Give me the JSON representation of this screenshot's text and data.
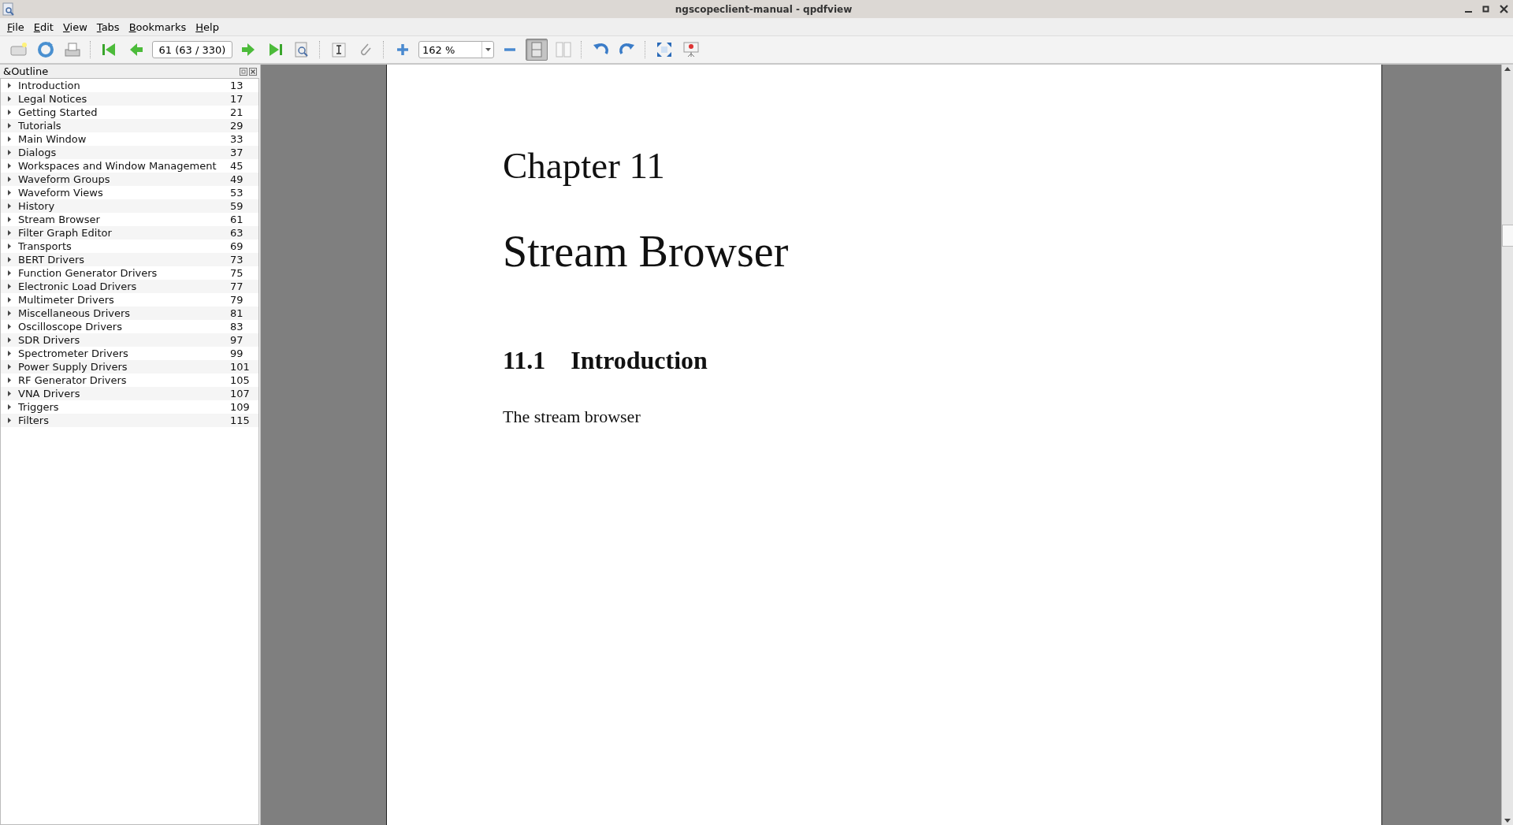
{
  "window": {
    "title": "ngscopeclient-manual - qpdfview"
  },
  "menu": [
    "File",
    "Edit",
    "View",
    "Tabs",
    "Bookmarks",
    "Help"
  ],
  "toolbar": [
    {
      "kind": "open"
    },
    {
      "kind": "refresh"
    },
    {
      "kind": "print"
    },
    {
      "kind": "separator"
    },
    {
      "kind": "first"
    },
    {
      "kind": "previous"
    },
    {
      "kind": "page-field",
      "value": "61 (63 / 330)"
    },
    {
      "kind": "next"
    },
    {
      "kind": "last"
    },
    {
      "kind": "search"
    },
    {
      "kind": "separator"
    },
    {
      "kind": "text-select"
    },
    {
      "kind": "attach"
    },
    {
      "kind": "separator"
    },
    {
      "kind": "zoom-in"
    },
    {
      "kind": "zoom-field",
      "value": "162 %"
    },
    {
      "kind": "zoom-out"
    },
    {
      "kind": "single-page",
      "checked": true
    },
    {
      "kind": "two-pages",
      "checked": false
    },
    {
      "kind": "separator"
    },
    {
      "kind": "rotate-left"
    },
    {
      "kind": "rotate-right"
    },
    {
      "kind": "separator"
    },
    {
      "kind": "fullscreen"
    },
    {
      "kind": "presentation"
    }
  ],
  "outline": {
    "title": "&Outline",
    "items": [
      {
        "title": "Introduction",
        "page": "13",
        "expanded": false
      },
      {
        "title": "Legal Notices",
        "page": "17",
        "expanded": false
      },
      {
        "title": "Getting Started",
        "page": "21",
        "expanded": false
      },
      {
        "title": "Tutorials",
        "page": "29",
        "expanded": false
      },
      {
        "title": "Main Window",
        "page": "33",
        "expanded": false
      },
      {
        "title": "Dialogs",
        "page": "37",
        "expanded": false
      },
      {
        "title": "Workspaces and Window Management",
        "page": "45",
        "expanded": false
      },
      {
        "title": "Waveform Groups",
        "page": "49",
        "expanded": false
      },
      {
        "title": "Waveform Views",
        "page": "53",
        "expanded": false
      },
      {
        "title": "History",
        "page": "59",
        "expanded": false
      },
      {
        "title": "Stream Browser",
        "page": "61",
        "expanded": false
      },
      {
        "title": "Filter Graph Editor",
        "page": "63",
        "expanded": false
      },
      {
        "title": "Transports",
        "page": "69",
        "expanded": false
      },
      {
        "title": "BERT Drivers",
        "page": "73",
        "expanded": false
      },
      {
        "title": "Function Generator Drivers",
        "page": "75",
        "expanded": false
      },
      {
        "title": "Electronic Load Drivers",
        "page": "77",
        "expanded": false
      },
      {
        "title": "Multimeter Drivers",
        "page": "79",
        "expanded": false
      },
      {
        "title": "Miscellaneous Drivers",
        "page": "81",
        "expanded": false
      },
      {
        "title": "Oscilloscope Drivers",
        "page": "83",
        "expanded": false
      },
      {
        "title": "SDR Drivers",
        "page": "97",
        "expanded": false
      },
      {
        "title": "Spectrometer Drivers",
        "page": "99",
        "expanded": false
      },
      {
        "title": "Power Supply Drivers",
        "page": "101",
        "expanded": false
      },
      {
        "title": "RF Generator Drivers",
        "page": "105",
        "expanded": false
      },
      {
        "title": "VNA Drivers",
        "page": "107",
        "expanded": false
      },
      {
        "title": "Triggers",
        "page": "109",
        "expanded": false
      },
      {
        "title": "Filters",
        "page": "115",
        "expanded": false
      }
    ]
  },
  "document": {
    "chapter": "Chapter 11",
    "title": "Stream Browser",
    "section_number": "11.1",
    "section_title": "Introduction",
    "paragraph": "The stream browser"
  }
}
